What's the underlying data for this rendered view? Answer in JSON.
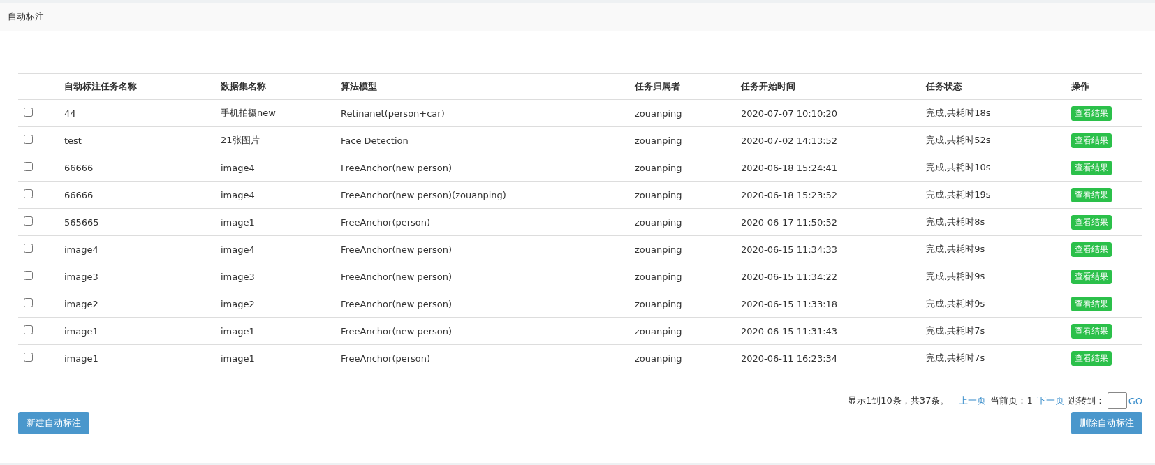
{
  "header": {
    "title": "自动标注"
  },
  "table": {
    "columns": [
      "自动标注任务名称",
      "数据集名称",
      "算法模型",
      "任务归属者",
      "任务开始时间",
      "任务状态",
      "操作"
    ],
    "rows": [
      {
        "checked": false,
        "name": "44",
        "dataset": "手机拍摄new",
        "model": "Retinanet(person+car)",
        "owner": "zouanping",
        "start": "2020-07-07 10:10:20",
        "status": "完成,共耗时18s",
        "action": "查看结果"
      },
      {
        "checked": false,
        "name": "test",
        "dataset": "21张图片",
        "model": "Face Detection",
        "owner": "zouanping",
        "start": "2020-07-02 14:13:52",
        "status": "完成,共耗时52s",
        "action": "查看结果"
      },
      {
        "checked": false,
        "name": "66666",
        "dataset": "image4",
        "model": "FreeAnchor(new person)",
        "owner": "zouanping",
        "start": "2020-06-18 15:24:41",
        "status": "完成,共耗时10s",
        "action": "查看结果"
      },
      {
        "checked": false,
        "name": "66666",
        "dataset": "image4",
        "model": "FreeAnchor(new person)(zouanping)",
        "owner": "zouanping",
        "start": "2020-06-18 15:23:52",
        "status": "完成,共耗时19s",
        "action": "查看结果"
      },
      {
        "checked": false,
        "name": "565665",
        "dataset": "image1",
        "model": "FreeAnchor(person)",
        "owner": "zouanping",
        "start": "2020-06-17 11:50:52",
        "status": "完成,共耗时8s",
        "action": "查看结果"
      },
      {
        "checked": false,
        "name": "image4",
        "dataset": "image4",
        "model": "FreeAnchor(new person)",
        "owner": "zouanping",
        "start": "2020-06-15 11:34:33",
        "status": "完成,共耗时9s",
        "action": "查看结果"
      },
      {
        "checked": false,
        "name": "image3",
        "dataset": "image3",
        "model": "FreeAnchor(new person)",
        "owner": "zouanping",
        "start": "2020-06-15 11:34:22",
        "status": "完成,共耗时9s",
        "action": "查看结果"
      },
      {
        "checked": false,
        "name": "image2",
        "dataset": "image2",
        "model": "FreeAnchor(new person)",
        "owner": "zouanping",
        "start": "2020-06-15 11:33:18",
        "status": "完成,共耗时9s",
        "action": "查看结果"
      },
      {
        "checked": false,
        "name": "image1",
        "dataset": "image1",
        "model": "FreeAnchor(new person)",
        "owner": "zouanping",
        "start": "2020-06-15 11:31:43",
        "status": "完成,共耗时7s",
        "action": "查看结果"
      },
      {
        "checked": false,
        "name": "image1",
        "dataset": "image1",
        "model": "FreeAnchor(person)",
        "owner": "zouanping",
        "start": "2020-06-11 16:23:34",
        "status": "完成,共耗时7s",
        "action": "查看结果"
      }
    ]
  },
  "pagination": {
    "summary": "显示1到10条，共37条。",
    "prev": "上一页",
    "current_label": "当前页：",
    "current": "1",
    "next": "下一页",
    "jump_label": "跳转到：",
    "go": "GO"
  },
  "buttons": {
    "create": "新建自动标注",
    "delete": "删除自动标注"
  }
}
